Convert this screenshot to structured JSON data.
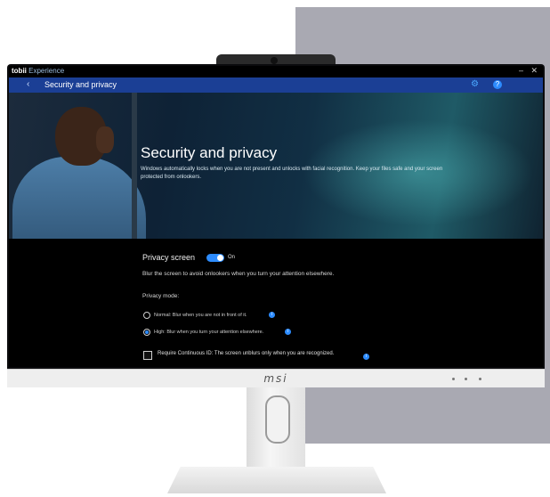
{
  "app": {
    "brand": "tobii",
    "product": "Experience",
    "min_glyph": "–",
    "close_glyph": "✕"
  },
  "nav": {
    "back_glyph": "‹",
    "title": "Security and privacy",
    "settings_icon": "gear-icon",
    "help_icon": "question-icon",
    "help_glyph": "?"
  },
  "hero": {
    "title": "Security and privacy",
    "description": "Windows automatically locks when you are not present and unlocks with facial recognition. Keep your files safe and your screen protected from onlookers."
  },
  "privacy_screen": {
    "label": "Privacy screen",
    "state": "On",
    "description": "Blur the screen to avoid onlookers when you turn your attention elsewhere.",
    "mode_label": "Privacy mode:",
    "options": [
      {
        "label": "Normal: Blur when you are not in front of it.",
        "selected": false
      },
      {
        "label": "High: Blur when you turn your attention elsewhere.",
        "selected": true
      }
    ],
    "continuous_id": {
      "label": "Require Continuous ID: The screen unblurs only when you are recognized.",
      "checked": false
    }
  },
  "monitor": {
    "logo": "msi"
  },
  "colors": {
    "accent": "#2d8cff",
    "navbar": "#1b3f95",
    "screen_bg": "#000000",
    "backdrop": "#a9a9b2"
  }
}
